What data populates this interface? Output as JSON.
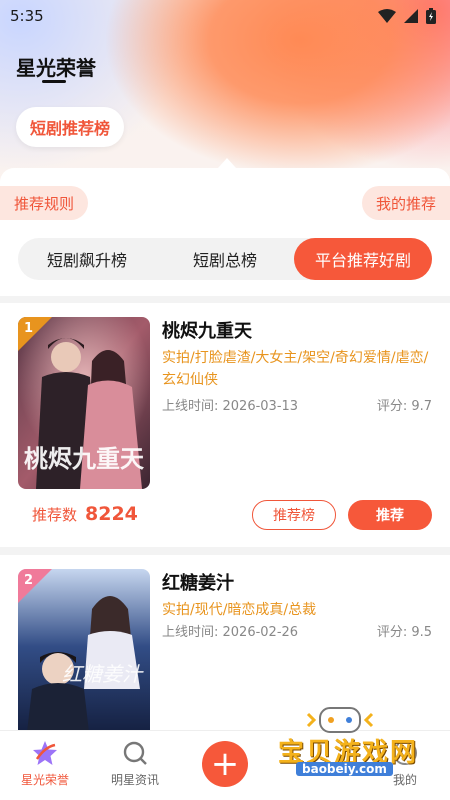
{
  "status_bar": {
    "time": "5:35"
  },
  "header": {
    "title": "星光荣誉",
    "section_chip": "短剧推荐榜"
  },
  "panel": {
    "left_pill": "推荐规则",
    "right_pill": "我的推荐",
    "tabs": [
      {
        "label": "短剧飙升榜",
        "active": false
      },
      {
        "label": "短剧总榜",
        "active": false
      },
      {
        "label": "平台推荐好剧",
        "active": true
      }
    ]
  },
  "dramas": [
    {
      "rank": "1",
      "title": "桃烬九重天",
      "tags": "实拍/打脸虐渣/大女主/架空/奇幻爱情/虐恋/玄幻仙侠",
      "release": "上线时间: 2026-03-13",
      "score": "评分: 9.7",
      "rec_label": "推荐数",
      "rec_count": "8224",
      "btn_rank": "推荐榜",
      "btn_recommend": "推荐",
      "poster_text": "桃烬九重天"
    },
    {
      "rank": "2",
      "title": "红糖姜汁",
      "tags": "实拍/现代/暗恋成真/总裁",
      "release": "上线时间: 2026-02-26",
      "score": "评分: 9.5",
      "poster_text": "红糖姜汁"
    }
  ],
  "bottom_nav": [
    {
      "label": "星光荣誉",
      "icon": "star-icon",
      "active": true
    },
    {
      "label": "明星资讯",
      "icon": "search-icon",
      "active": false
    },
    {
      "label": "",
      "icon": "plus-icon",
      "active": false
    },
    {
      "label": "",
      "icon": "",
      "active": false
    },
    {
      "label": "我的",
      "icon": "profile-icon",
      "active": false
    }
  ],
  "watermark": {
    "text": "宝贝游戏网",
    "url": "baobeiy.com"
  },
  "colors": {
    "accent": "#f6583a",
    "tag": "#e8941e",
    "pill_bg": "#fde6df"
  }
}
